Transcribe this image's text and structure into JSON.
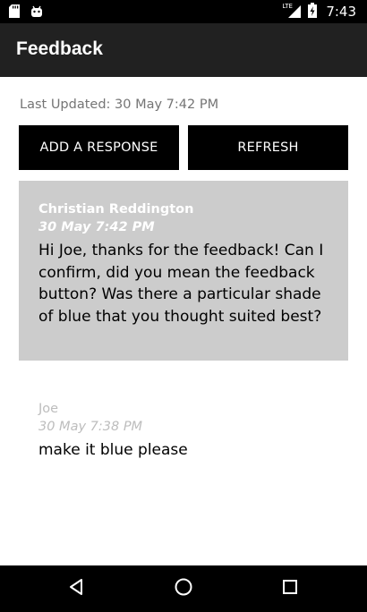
{
  "status_bar": {
    "time": "7:43",
    "network": "LTE",
    "icons": [
      "sd-card-icon",
      "android-icon",
      "lte-signal-icon",
      "battery-charging-icon"
    ]
  },
  "app_bar": {
    "title": "Feedback"
  },
  "last_updated": "Last Updated: 30 May 7:42 PM",
  "buttons": {
    "add_response": "ADD A RESPONSE",
    "refresh": "REFRESH"
  },
  "responses": [
    {
      "author": "Christian Reddington",
      "timestamp": "30 May 7:42 PM",
      "message": "Hi Joe, thanks for the feedback! Can I confirm, did you mean the feedback button? Was there a particular shade of blue that you thought suited best?"
    },
    {
      "author": "Joe",
      "timestamp": "30 May 7:38 PM",
      "message": "make it blue please"
    }
  ],
  "nav_bar": {
    "icons": [
      "back-icon",
      "home-icon",
      "recents-icon"
    ]
  },
  "colors": {
    "status_bar": "#000000",
    "app_bar": "#212121",
    "button_bg": "#000000",
    "highlight_card": "#cccccc",
    "muted_text": "#bdbdbd"
  }
}
